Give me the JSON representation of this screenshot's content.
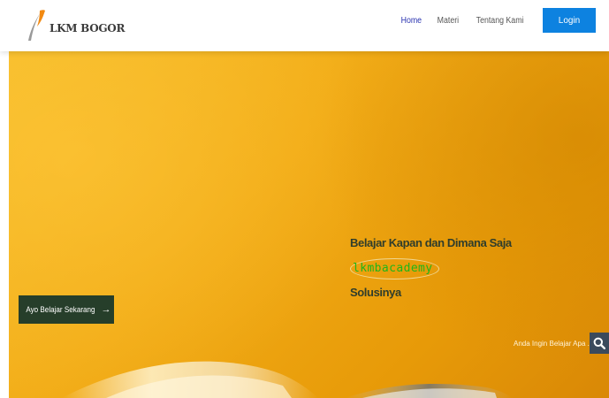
{
  "brand": {
    "name": "LKM BOGOR",
    "logo_icon": "lkm-swoosh-logo",
    "colors": {
      "orange": "#f28a12",
      "gray": "#9a9a9a"
    }
  },
  "nav": {
    "items": [
      {
        "label": "Home",
        "active": true
      },
      {
        "label": "Materi",
        "active": false
      },
      {
        "label": "Tentang Kami",
        "active": false
      }
    ],
    "login_label": "Login",
    "colors": {
      "active": "#2a33b0",
      "login_bg": "#0d82e0"
    }
  },
  "hero": {
    "headline_prefix": "Belajar Kapan dan Dimana Saja",
    "headline_brand": "lkmbacademy",
    "headline_suffix": "Solusinya",
    "cta_label": "Ayo Belajar Sekarang",
    "cta_icon": "arrow-right-icon",
    "search_placeholder": "Anda Ingin Belajar Apa .",
    "search_icon": "search-icon",
    "colors": {
      "background": "#f2ac17",
      "brand_text": "#1fb51a",
      "cta_bg": "#263e2a"
    }
  }
}
